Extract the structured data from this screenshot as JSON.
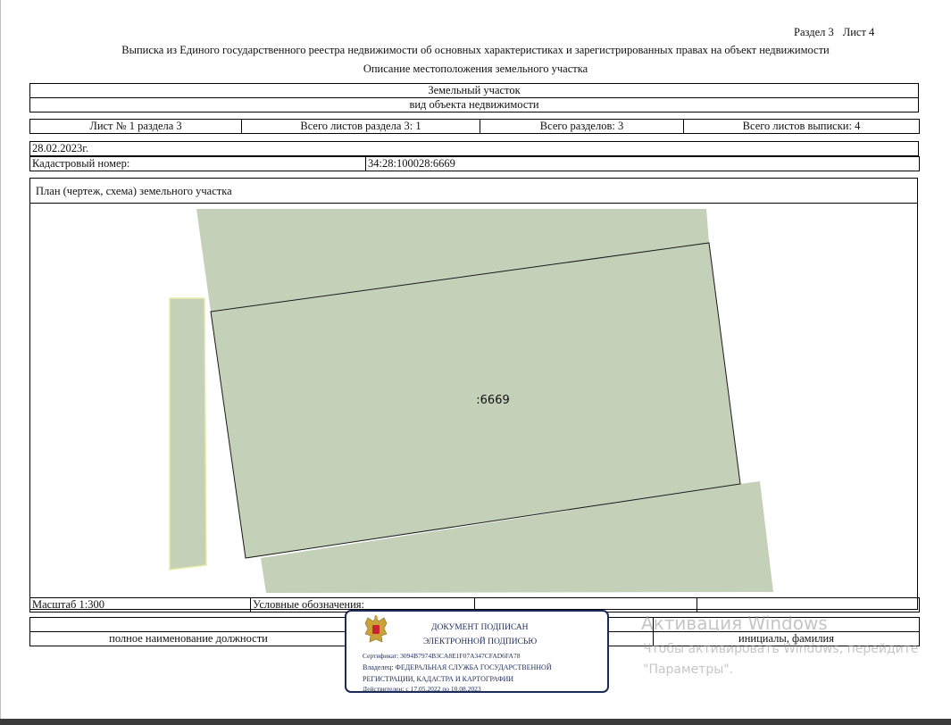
{
  "header": {
    "section": "Раздел 3",
    "sheet": "Лист 4",
    "title": "Выписка из Единого государственного реестра недвижимости об основных характеристиках и зарегистрированных правах на объект недвижимости",
    "subtitle": "Описание местоположения земельного участка"
  },
  "object": {
    "type": "Земельный участок",
    "type_caption": "вид объекта недвижимости"
  },
  "sheets_row": {
    "sheet_of_section": "Лист № 1 раздела 3",
    "total_section_sheets": "Всего листов раздела 3: 1",
    "total_sections": "Всего разделов: 3",
    "total_extract_sheets": "Всего листов выписки: 4"
  },
  "date": "28.02.2023г.",
  "cadastral": {
    "label": "Кадастровый номер:",
    "value": "34:28:100028:6669"
  },
  "plan": {
    "title": "План (чертеж, схема) земельного участка",
    "parcel_label": ":6669",
    "colors": {
      "parcel_fill": "#c4d0b8",
      "stroke": "#1a1a1a",
      "edge": "#e6eda6"
    }
  },
  "footer": {
    "scale": "Масштаб 1:300",
    "legend_label": "Условные обозначения:",
    "position_caption": "полное наименование должности",
    "name_caption": "инициалы, фамилия"
  },
  "stamp": {
    "line1": "ДОКУМЕНТ ПОДПИСАН",
    "line2": "ЭЛЕКТРОННОЙ ПОДПИСЬЮ",
    "certificate": "Сертификат: 3094B7974B3CA8E1F07A347CFAD6FA78",
    "owner_line1": "Владелец: ФЕДЕРАЛЬНАЯ СЛУЖБА ГОСУДАРСТВЕННОЙ",
    "owner_line2": "РЕГИСТРАЦИИ, КАДАСТРА И КАРТОГРАФИИ",
    "valid": "Действителен: с 17.05.2022 по 10.08.2023",
    "emblem_icon": "double-headed-eagle-emblem-icon"
  },
  "watermark": {
    "title": "Активация Windows",
    "line1": "Чтобы активировать Windows, перейдите",
    "line2": "\"Параметры\"."
  }
}
